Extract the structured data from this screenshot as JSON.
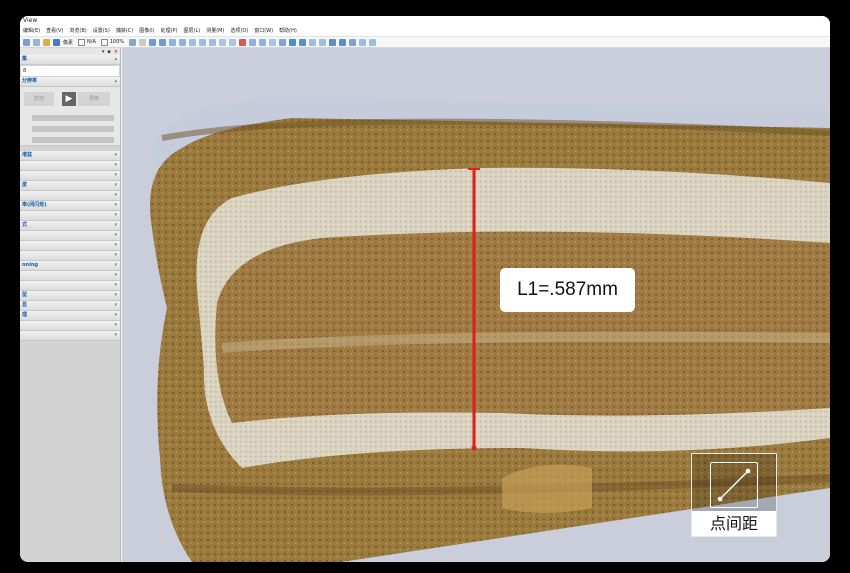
{
  "window": {
    "title": "View"
  },
  "menu": [
    "编辑(E)",
    "查看(V)",
    "浏览(B)",
    "设置(S)",
    "捕获(C)",
    "图像(I)",
    "处理(P)",
    "图层(L)",
    "测量(M)",
    "选项(O)",
    "窗口(W)",
    "帮助(H)"
  ],
  "toolbar": {
    "unit": "像素",
    "scale": "N/A",
    "zoom": "100%"
  },
  "sidebar": {
    "sections": [
      {
        "label": "集",
        "field": "8"
      },
      {
        "label": "分辨率"
      }
    ],
    "camera_buttons": {
      "left": "抓拍",
      "right": "录像"
    },
    "lower_sections": [
      "增益",
      "",
      "",
      "度",
      "",
      "率(闭闪烁)",
      "",
      "式",
      "",
      "",
      "",
      "nning",
      "",
      "",
      "型",
      "显",
      "理",
      "",
      ""
    ]
  },
  "measurement": {
    "label": "L1=.587mm",
    "line_color": "#e01e1e"
  },
  "tool": {
    "label": "点间距",
    "icon": "point-distance-icon"
  },
  "colors": {
    "accent_blue": "#1a5ea8",
    "measure_red": "#e01e1e"
  }
}
